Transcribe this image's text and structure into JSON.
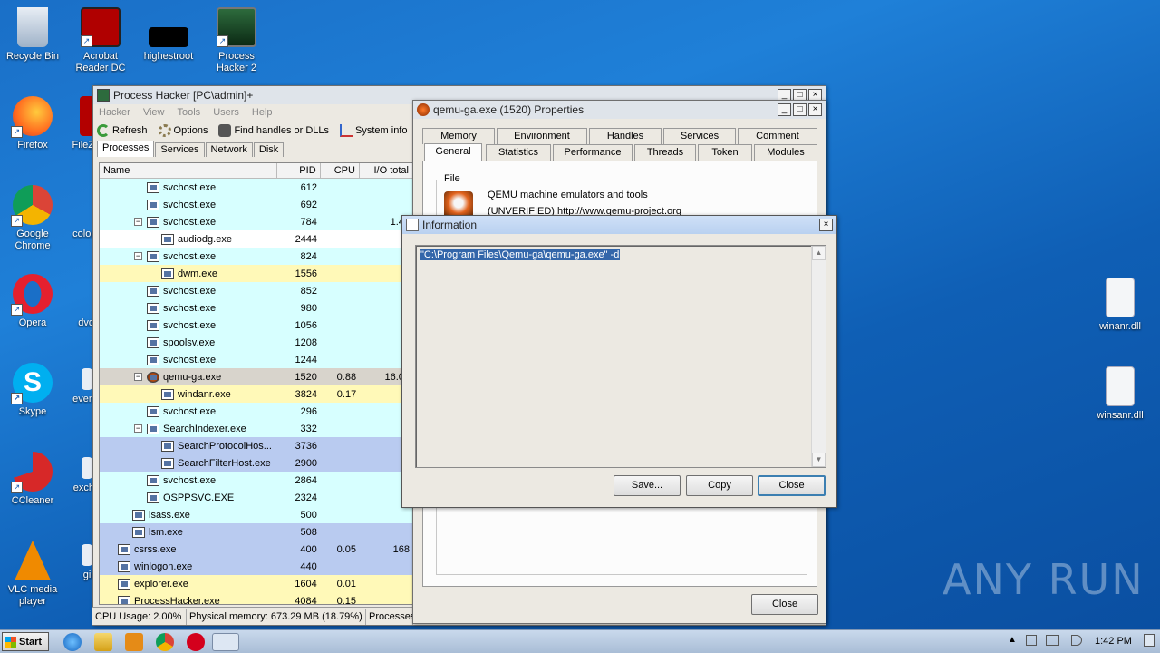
{
  "desktop": {
    "icons": [
      {
        "label": "Recycle Bin",
        "icon": "recycle-bin-icon"
      },
      {
        "label": "Acrobat Reader DC",
        "icon": "acrobat-icon"
      },
      {
        "label": "highestroot",
        "icon": "black-file-icon"
      },
      {
        "label": "Process Hacker 2",
        "icon": "process-hacker-icon"
      },
      {
        "label": "Firefox",
        "icon": "firefox-icon"
      },
      {
        "label": "FileZ",
        "icon": "filezilla-icon"
      },
      {
        "label": "Google Chrome",
        "icon": "chrome-icon"
      },
      {
        "label": "color",
        "icon": "file-icon"
      },
      {
        "label": "Opera",
        "icon": "opera-icon"
      },
      {
        "label": "dvd",
        "icon": "file-icon"
      },
      {
        "label": "Skype",
        "icon": "skype-icon"
      },
      {
        "label": "even",
        "icon": "file-icon"
      },
      {
        "label": "CCleaner",
        "icon": "ccleaner-icon"
      },
      {
        "label": "exch",
        "icon": "file-icon"
      },
      {
        "label": "VLC media player",
        "icon": "vlc-icon"
      },
      {
        "label": "gir",
        "icon": "file-icon"
      },
      {
        "label": "winanr.dll",
        "icon": "dll-icon"
      },
      {
        "label": "winsanr.dll",
        "icon": "dll-icon"
      }
    ]
  },
  "ph": {
    "title": "Process Hacker [PC\\admin]+",
    "menu": [
      "Hacker",
      "View",
      "Tools",
      "Users",
      "Help"
    ],
    "toolbar": {
      "refresh": "Refresh",
      "options": "Options",
      "find": "Find handles or DLLs",
      "sysinfo": "System info"
    },
    "tabs": [
      "Processes",
      "Services",
      "Network",
      "Disk"
    ],
    "columns": [
      "Name",
      "PID",
      "CPU",
      "I/O total"
    ],
    "rows": [
      {
        "name": "svchost.exe",
        "pid": "612",
        "cpu": "",
        "io": ""
      },
      {
        "name": "svchost.exe",
        "pid": "692",
        "cpu": "",
        "io": ""
      },
      {
        "name": "svchost.exe",
        "pid": "784",
        "cpu": "",
        "io": "1.48"
      },
      {
        "name": "audiodg.exe",
        "pid": "2444",
        "cpu": "",
        "io": ""
      },
      {
        "name": "svchost.exe",
        "pid": "824",
        "cpu": "",
        "io": ""
      },
      {
        "name": "dwm.exe",
        "pid": "1556",
        "cpu": "",
        "io": ""
      },
      {
        "name": "svchost.exe",
        "pid": "852",
        "cpu": "",
        "io": ""
      },
      {
        "name": "svchost.exe",
        "pid": "980",
        "cpu": "",
        "io": ""
      },
      {
        "name": "svchost.exe",
        "pid": "1056",
        "cpu": "",
        "io": ""
      },
      {
        "name": "spoolsv.exe",
        "pid": "1208",
        "cpu": "",
        "io": ""
      },
      {
        "name": "svchost.exe",
        "pid": "1244",
        "cpu": "",
        "io": ""
      },
      {
        "name": "qemu-ga.exe",
        "pid": "1520",
        "cpu": "0.88",
        "io": "16.02"
      },
      {
        "name": "windanr.exe",
        "pid": "3824",
        "cpu": "0.17",
        "io": ""
      },
      {
        "name": "svchost.exe",
        "pid": "296",
        "cpu": "",
        "io": ""
      },
      {
        "name": "SearchIndexer.exe",
        "pid": "332",
        "cpu": "",
        "io": ""
      },
      {
        "name": "SearchProtocolHos...",
        "pid": "3736",
        "cpu": "",
        "io": ""
      },
      {
        "name": "SearchFilterHost.exe",
        "pid": "2900",
        "cpu": "",
        "io": ""
      },
      {
        "name": "svchost.exe",
        "pid": "2864",
        "cpu": "",
        "io": ""
      },
      {
        "name": "OSPPSVC.EXE",
        "pid": "2324",
        "cpu": "",
        "io": ""
      },
      {
        "name": "lsass.exe",
        "pid": "500",
        "cpu": "",
        "io": ""
      },
      {
        "name": "lsm.exe",
        "pid": "508",
        "cpu": "",
        "io": ""
      },
      {
        "name": "csrss.exe",
        "pid": "400",
        "cpu": "0.05",
        "io": "168"
      },
      {
        "name": "winlogon.exe",
        "pid": "440",
        "cpu": "",
        "io": ""
      },
      {
        "name": "explorer.exe",
        "pid": "1604",
        "cpu": "0.01",
        "io": ""
      },
      {
        "name": "ProcessHacker.exe",
        "pid": "4084",
        "cpu": "0.15",
        "io": ""
      }
    ],
    "status": {
      "cpu": "CPU Usage: 2.00%",
      "mem": "Physical memory: 673.29 MB (18.79%)",
      "procs": "Processes"
    }
  },
  "props": {
    "title": "qemu-ga.exe (1520) Properties",
    "tabs_top": [
      "Memory",
      "Environment",
      "Handles",
      "Services",
      "Comment"
    ],
    "tabs_bottom": [
      "General",
      "Statistics",
      "Performance",
      "Threads",
      "Token",
      "Modules"
    ],
    "file_group": "File",
    "file_desc": "QEMU machine emulators and tools",
    "file_company": "(UNVERIFIED) http://www.qemu-project.org",
    "close": "Close"
  },
  "info": {
    "title": "Information",
    "text": "\"C:\\Program Files\\Qemu-ga\\qemu-ga.exe\" -d",
    "save": "Save...",
    "copy": "Copy",
    "close": "Close"
  },
  "taskbar": {
    "start": "Start",
    "time": "1:42 PM"
  },
  "watermark": "ANY RUN"
}
